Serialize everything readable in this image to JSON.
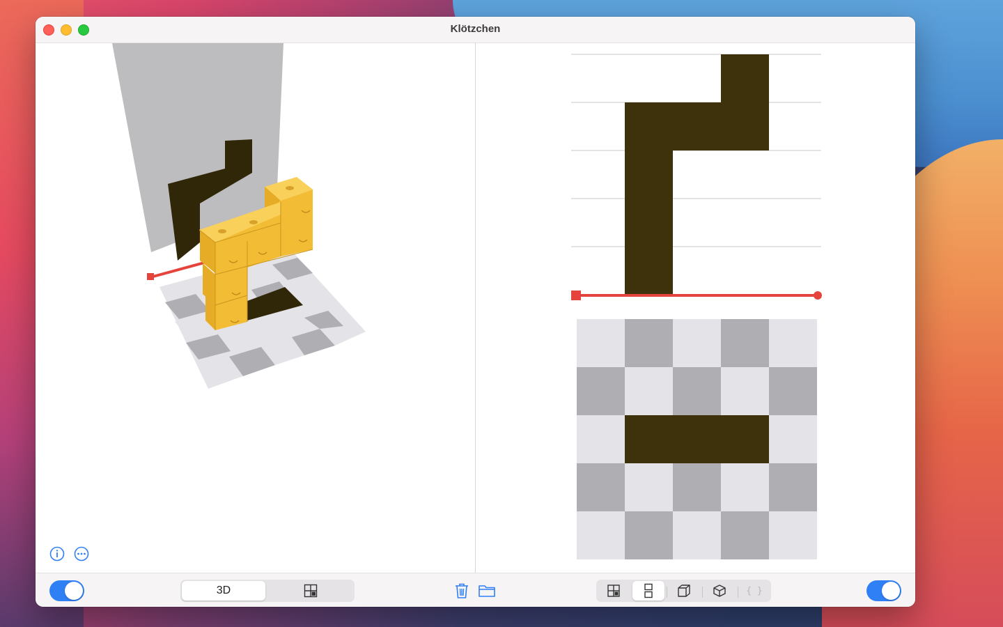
{
  "window": {
    "title": "Klötzchen"
  },
  "colors": {
    "accent": "#2f7ff5",
    "shadow_fill": "#3e320d",
    "cube_yellow": "#f6c23a",
    "axis_red": "#e5443c",
    "tile_dark": "#afaeb2",
    "tile_light": "#e4e3e8",
    "gridline": "#c9c9c9"
  },
  "left_pane": {
    "info_icon": "info-circle-icon",
    "more_icon": "ellipsis-circle-icon"
  },
  "right_pane": {
    "side_view": {
      "rows": 5,
      "cols": 5,
      "filled": [
        [
          0,
          3
        ],
        [
          1,
          1
        ],
        [
          1,
          2
        ],
        [
          1,
          3
        ],
        [
          2,
          1
        ],
        [
          3,
          1
        ],
        [
          4,
          1
        ]
      ]
    },
    "top_view": {
      "rows": 5,
      "cols": 5,
      "filled": [
        [
          2,
          1
        ],
        [
          2,
          2
        ],
        [
          2,
          3
        ]
      ]
    }
  },
  "toolbar": {
    "left_toggle_on": true,
    "view_segments": [
      {
        "label": "3D",
        "selected": true
      },
      {
        "label": "",
        "icon": "grid-layout-icon",
        "selected": false
      }
    ],
    "trash_icon": "trash-icon",
    "folder_icon": "folder-icon",
    "projection_segments": [
      {
        "icon": "quad-grid-icon",
        "selected": false
      },
      {
        "icon": "stacked-squares-icon",
        "selected": true
      },
      {
        "icon": "cube-outline-icon",
        "selected": false
      },
      {
        "icon": "isometric-cube-icon",
        "selected": false
      },
      {
        "label": "{ }",
        "icon": "braces-icon",
        "selected": false,
        "disabled": true
      }
    ],
    "right_toggle_on": true
  }
}
